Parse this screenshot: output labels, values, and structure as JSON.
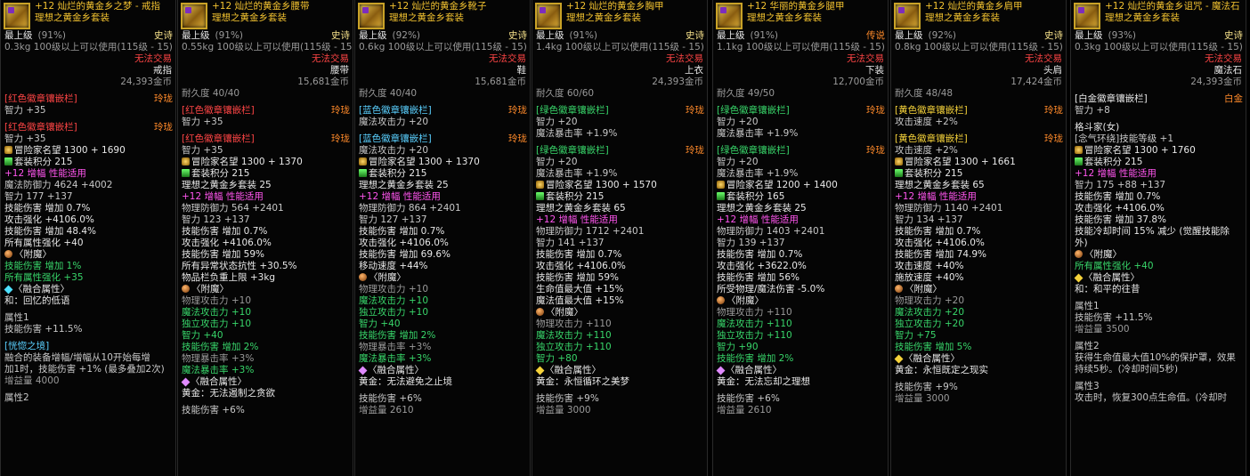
{
  "cards": [
    {
      "title": "+12 灿烂的黄金乡之梦 - 戒指",
      "set": "理想之黄金乡套装",
      "rows": [
        {
          "t": "最上级",
          "p": "(91%)",
          "r": "史诗",
          "rc": "ep",
          "c": "w"
        },
        {
          "t": "0.3kg  100级以上可以使用(115级 - 15)",
          "c": "dg"
        },
        {
          "t": "无法交易",
          "c": "r",
          "align": "right"
        },
        {
          "t": "戒指",
          "c": "w",
          "align": "right"
        },
        {
          "t": "24,393金币",
          "c": "dg",
          "align": "right"
        },
        {
          "gap": 1
        },
        {
          "t": "[红色徽章镶嵌栏]",
          "r": "玲珑",
          "rc": "lg",
          "c": "r"
        },
        {
          "t": "  智力 +35",
          "c": "g"
        },
        {
          "gap": 1
        },
        {
          "t": "[红色徽章镶嵌栏]",
          "r": "玲珑",
          "rc": "lg",
          "c": "r"
        },
        {
          "t": "  智力 +35",
          "c": "g"
        },
        {
          "t": "冒险家名望 1300 + 1690",
          "c": "w",
          "b": "fame"
        },
        {
          "t": "套装积分 215",
          "c": "w",
          "b": "set"
        },
        {
          "t": "+12 增幅 性能适用",
          "c": "pk"
        },
        {
          "t": "魔法防御力 4624 +4002",
          "c": "g"
        },
        {
          "t": "智力 177 +137",
          "c": "g"
        },
        {
          "t": "技能伤害 增加 0.7%",
          "c": "w"
        },
        {
          "t": "攻击强化 +4106.0%",
          "c": "w"
        },
        {
          "t": "技能伤害 增加 48.4%",
          "c": "w"
        },
        {
          "t": "所有属性强化 +40",
          "c": "w"
        },
        {
          "t": "〈附魔〉",
          "c": "w",
          "b": "ench"
        },
        {
          "t": "技能伤害 增加 1%",
          "c": "gr"
        },
        {
          "t": "所有属性强化 +35",
          "c": "gr"
        },
        {
          "t": "〈融合属性〉",
          "c": "w",
          "b": "cyan"
        },
        {
          "t": "  和：回忆的低语",
          "c": "w"
        },
        {
          "gap": 1
        },
        {
          "t": "属性1",
          "c": "g"
        },
        {
          "t": "技能伤害 +11.5%",
          "c": "g"
        },
        {
          "gap": 1
        },
        {
          "t": "[恍惚之境]",
          "c": "bl"
        },
        {
          "t": "融合的装备增幅/增幅从10开始每增",
          "c": "g"
        },
        {
          "t": "加1时，技能伤害 +1% (最多叠加2次)",
          "c": "g"
        },
        {
          "t": "增益量 4000",
          "c": "dg"
        },
        {
          "gap": 1
        },
        {
          "t": "属性2",
          "c": "g"
        }
      ]
    },
    {
      "title": "+12 灿烂的黄金乡腰带",
      "set": "理想之黄金乡套装",
      "rows": [
        {
          "t": "最上级",
          "p": "(91%)",
          "r": "史诗",
          "rc": "ep",
          "c": "w"
        },
        {
          "t": "0.55kg 100级以上可以使用(115级 - 15)",
          "c": "dg"
        },
        {
          "t": "无法交易",
          "c": "r",
          "align": "right"
        },
        {
          "t": "腰带",
          "c": "w",
          "align": "right"
        },
        {
          "t": "15,681金币",
          "c": "dg",
          "align": "right"
        },
        {
          "t": "耐久度 40/40",
          "c": "dg"
        },
        {
          "gap": 1
        },
        {
          "t": "[红色徽章镶嵌栏]",
          "r": "玲珑",
          "rc": "lg",
          "c": "r"
        },
        {
          "t": "  智力 +35",
          "c": "g"
        },
        {
          "gap": 1
        },
        {
          "t": "[红色徽章镶嵌栏]",
          "r": "玲珑",
          "rc": "lg",
          "c": "r"
        },
        {
          "t": "  智力 +35",
          "c": "g"
        },
        {
          "t": "冒险家名望 1300 + 1370",
          "c": "w",
          "b": "fame"
        },
        {
          "t": "套装积分 215",
          "c": "w",
          "b": "set"
        },
        {
          "t": "  理想之黄金乡套装 25",
          "c": "w"
        },
        {
          "t": "+12 增幅 性能适用",
          "c": "pk"
        },
        {
          "t": "物理防御力 564 +2401",
          "c": "g"
        },
        {
          "t": "智力 123 +137",
          "c": "g"
        },
        {
          "t": "技能伤害 增加 0.7%",
          "c": "w"
        },
        {
          "t": "攻击强化 +4106.0%",
          "c": "w"
        },
        {
          "t": "技能伤害 增加 59%",
          "c": "w"
        },
        {
          "t": "所有异常状态抗性 +30.5%",
          "c": "w"
        },
        {
          "t": "物品栏负重上限 +3kg",
          "c": "w"
        },
        {
          "t": "〈附魔〉",
          "c": "w",
          "b": "ench"
        },
        {
          "t": "物理攻击力 +10",
          "c": "dg"
        },
        {
          "t": "魔法攻击力 +10",
          "c": "gr"
        },
        {
          "t": "独立攻击力 +10",
          "c": "gr"
        },
        {
          "t": "智力 +40",
          "c": "gr"
        },
        {
          "t": "技能伤害 增加 2%",
          "c": "gr"
        },
        {
          "t": "物理暴击率 +3%",
          "c": "dg"
        },
        {
          "t": "魔法暴击率 +3%",
          "c": "gr"
        },
        {
          "t": "〈融合属性〉",
          "c": "w",
          "b": "fuse"
        },
        {
          "t": "  黄金：无法遏制之贪欲",
          "c": "w"
        },
        {
          "gap": 1
        },
        {
          "t": "技能伤害 +6%",
          "c": "g"
        }
      ]
    },
    {
      "title": "+12 灿烂的黄金乡靴子",
      "set": "理想之黄金乡套装",
      "rows": [
        {
          "t": "最上级",
          "p": "(92%)",
          "r": "史诗",
          "rc": "ep",
          "c": "w"
        },
        {
          "t": "0.6kg  100级以上可以使用(115级 - 15)",
          "c": "dg"
        },
        {
          "t": "无法交易",
          "c": "r",
          "align": "right"
        },
        {
          "t": "鞋",
          "c": "w",
          "align": "right"
        },
        {
          "t": "15,681金币",
          "c": "dg",
          "align": "right"
        },
        {
          "t": "耐久度 40/40",
          "c": "dg"
        },
        {
          "gap": 1
        },
        {
          "t": "[蓝色徽章镶嵌栏]",
          "r": "玲珑",
          "rc": "lg",
          "c": "bl"
        },
        {
          "t": "  魔法攻击力 +20",
          "c": "g"
        },
        {
          "gap": 1
        },
        {
          "t": "[蓝色徽章镶嵌栏]",
          "r": "玲珑",
          "rc": "lg",
          "c": "bl"
        },
        {
          "t": "  魔法攻击力 +20",
          "c": "g"
        },
        {
          "t": "冒险家名望 1300 + 1370",
          "c": "w",
          "b": "fame"
        },
        {
          "t": "套装积分 215",
          "c": "w",
          "b": "set"
        },
        {
          "t": "  理想之黄金乡套装 25",
          "c": "w"
        },
        {
          "t": "+12 增幅 性能适用",
          "c": "pk"
        },
        {
          "t": "物理防御力 864 +2401",
          "c": "g"
        },
        {
          "t": "智力 127 +137",
          "c": "g"
        },
        {
          "t": "技能伤害 增加 0.7%",
          "c": "w"
        },
        {
          "t": "攻击强化 +4106.0%",
          "c": "w"
        },
        {
          "t": "技能伤害 增加 69.6%",
          "c": "w"
        },
        {
          "t": "移动速度 +44%",
          "c": "w"
        },
        {
          "t": "〈附魔〉",
          "c": "w",
          "b": "ench"
        },
        {
          "t": "物理攻击力 +10",
          "c": "dg"
        },
        {
          "t": "魔法攻击力 +10",
          "c": "gr"
        },
        {
          "t": "独立攻击力 +10",
          "c": "gr"
        },
        {
          "t": "智力 +40",
          "c": "gr"
        },
        {
          "t": "技能伤害 增加 2%",
          "c": "gr"
        },
        {
          "t": "物理暴击率 +3%",
          "c": "dg"
        },
        {
          "t": "魔法暴击率 +3%",
          "c": "gr"
        },
        {
          "t": "〈融合属性〉",
          "c": "w",
          "b": "fuse"
        },
        {
          "t": "  黄金：无法避免之止境",
          "c": "w"
        },
        {
          "gap": 1
        },
        {
          "t": "技能伤害 +6%",
          "c": "g"
        },
        {
          "t": "增益量 2610",
          "c": "dg"
        }
      ]
    },
    {
      "title": "+12 灿烂的黄金乡胸甲",
      "set": "理想之黄金乡套装",
      "rows": [
        {
          "t": "最上级",
          "p": "(91%)",
          "r": "史诗",
          "rc": "ep",
          "c": "w"
        },
        {
          "t": "1.4kg  100级以上可以使用(115级 - 15)",
          "c": "dg"
        },
        {
          "t": "无法交易",
          "c": "r",
          "align": "right"
        },
        {
          "t": "上衣",
          "c": "w",
          "align": "right"
        },
        {
          "t": "24,393金币",
          "c": "dg",
          "align": "right"
        },
        {
          "t": "耐久度 60/60",
          "c": "dg"
        },
        {
          "gap": 1
        },
        {
          "t": "[绿色徽章镶嵌栏]",
          "r": "玲珑",
          "rc": "lg",
          "c": "gr"
        },
        {
          "t": "  智力 +20",
          "c": "g"
        },
        {
          "t": "  魔法暴击率 +1.9%",
          "c": "g"
        },
        {
          "gap": 1
        },
        {
          "t": "[绿色徽章镶嵌栏]",
          "r": "玲珑",
          "rc": "lg",
          "c": "gr"
        },
        {
          "t": "  智力 +20",
          "c": "g"
        },
        {
          "t": "  魔法暴击率 +1.9%",
          "c": "g"
        },
        {
          "t": "冒险家名望 1300 + 1570",
          "c": "w",
          "b": "fame"
        },
        {
          "t": "套装积分 215",
          "c": "w",
          "b": "set"
        },
        {
          "t": "  理想之黄金乡套装 65",
          "c": "w"
        },
        {
          "t": "+12 增幅 性能适用",
          "c": "pk"
        },
        {
          "t": "物理防御力 1712 +2401",
          "c": "g"
        },
        {
          "t": "智力 141 +137",
          "c": "g"
        },
        {
          "t": "技能伤害 增加 0.7%",
          "c": "w"
        },
        {
          "t": "攻击强化 +4106.0%",
          "c": "w"
        },
        {
          "t": "技能伤害 增加 59%",
          "c": "w"
        },
        {
          "t": "生命值最大值 +15%",
          "c": "w"
        },
        {
          "t": "魔法值最大值 +15%",
          "c": "w"
        },
        {
          "t": "〈附魔〉",
          "c": "w",
          "b": "ench"
        },
        {
          "t": "物理攻击力 +110",
          "c": "dg"
        },
        {
          "t": "魔法攻击力 +110",
          "c": "gr"
        },
        {
          "t": "独立攻击力 +110",
          "c": "gr"
        },
        {
          "t": "智力 +80",
          "c": "gr"
        },
        {
          "t": "〈融合属性〉",
          "c": "w",
          "b": "fuse2"
        },
        {
          "t": "  黄金：永恒循环之美梦",
          "c": "w"
        },
        {
          "gap": 1
        },
        {
          "t": "技能伤害 +9%",
          "c": "g"
        },
        {
          "t": "增益量 3000",
          "c": "dg"
        }
      ]
    },
    {
      "title": "+12 华丽的黄金乡腿甲",
      "set": "理想之黄金乡套装",
      "rows": [
        {
          "t": "最上级",
          "p": "(91%)",
          "r": "传说",
          "rc": "lg",
          "c": "w"
        },
        {
          "t": "1.1kg  100级以上可以使用(115级 - 15)",
          "c": "dg"
        },
        {
          "t": "无法交易",
          "c": "r",
          "align": "right"
        },
        {
          "t": "下装",
          "c": "w",
          "align": "right"
        },
        {
          "t": "12,700金币",
          "c": "dg",
          "align": "right"
        },
        {
          "t": "耐久度 49/50",
          "c": "dg"
        },
        {
          "gap": 1
        },
        {
          "t": "[绿色徽章镶嵌栏]",
          "r": "玲珑",
          "rc": "lg",
          "c": "gr"
        },
        {
          "t": "  智力 +20",
          "c": "g"
        },
        {
          "t": "  魔法暴击率 +1.9%",
          "c": "g"
        },
        {
          "gap": 1
        },
        {
          "t": "[绿色徽章镶嵌栏]",
          "r": "玲珑",
          "rc": "lg",
          "c": "gr"
        },
        {
          "t": "  智力 +20",
          "c": "g"
        },
        {
          "t": "  魔法暴击率 +1.9%",
          "c": "g"
        },
        {
          "t": "冒险家名望 1200 + 1400",
          "c": "w",
          "b": "fame"
        },
        {
          "t": "套装积分 165",
          "c": "w",
          "b": "set"
        },
        {
          "t": "  理想之黄金乡套装 25",
          "c": "w"
        },
        {
          "t": "+12 增幅 性能适用",
          "c": "pk"
        },
        {
          "t": "物理防御力 1403 +2401",
          "c": "g"
        },
        {
          "t": "智力 139 +137",
          "c": "g"
        },
        {
          "t": "技能伤害 增加 0.7%",
          "c": "w"
        },
        {
          "t": "攻击强化 +3622.0%",
          "c": "w"
        },
        {
          "t": "技能伤害 增加 56%",
          "c": "w"
        },
        {
          "t": "所受物理/魔法伤害 -5.0%",
          "c": "w"
        },
        {
          "t": "〈附魔〉",
          "c": "w",
          "b": "ench"
        },
        {
          "t": "物理攻击力 +110",
          "c": "dg"
        },
        {
          "t": "魔法攻击力 +110",
          "c": "gr"
        },
        {
          "t": "独立攻击力 +110",
          "c": "gr"
        },
        {
          "t": "智力 +90",
          "c": "gr"
        },
        {
          "t": "技能伤害 增加 2%",
          "c": "gr"
        },
        {
          "t": "〈融合属性〉",
          "c": "w",
          "b": "fuse"
        },
        {
          "t": "  黄金：无法忘却之理想",
          "c": "w"
        },
        {
          "gap": 1
        },
        {
          "t": "技能伤害 +6%",
          "c": "g"
        },
        {
          "t": "增益量 2610",
          "c": "dg"
        }
      ]
    },
    {
      "title": "+12 灿烂的黄金乡肩甲",
      "set": "理想之黄金乡套装",
      "rows": [
        {
          "t": "最上级",
          "p": "(92%)",
          "r": "史诗",
          "rc": "ep",
          "c": "w"
        },
        {
          "t": "0.8kg  100级以上可以使用(115级 - 15)",
          "c": "dg"
        },
        {
          "t": "无法交易",
          "c": "r",
          "align": "right"
        },
        {
          "t": "头肩",
          "c": "w",
          "align": "right"
        },
        {
          "t": "17,424金币",
          "c": "dg",
          "align": "right"
        },
        {
          "t": "耐久度 48/48",
          "c": "dg"
        },
        {
          "gap": 1
        },
        {
          "t": "[黄色徽章镶嵌栏]",
          "r": "玲珑",
          "rc": "lg",
          "c": "y"
        },
        {
          "t": "  攻击速度 +2%",
          "c": "g"
        },
        {
          "gap": 1
        },
        {
          "t": "[黄色徽章镶嵌栏]",
          "r": "玲珑",
          "rc": "lg",
          "c": "y"
        },
        {
          "t": "  攻击速度 +2%",
          "c": "g"
        },
        {
          "t": "冒险家名望 1300 + 1661",
          "c": "w",
          "b": "fame"
        },
        {
          "t": "套装积分 215",
          "c": "w",
          "b": "set"
        },
        {
          "t": "  理想之黄金乡套装 65",
          "c": "w"
        },
        {
          "t": "+12 增幅 性能适用",
          "c": "pk"
        },
        {
          "t": "物理防御力 1140 +2401",
          "c": "g"
        },
        {
          "t": "智力 134 +137",
          "c": "g"
        },
        {
          "t": "技能伤害 增加 0.7%",
          "c": "w"
        },
        {
          "t": "攻击强化 +4106.0%",
          "c": "w"
        },
        {
          "t": "技能伤害 增加 74.9%",
          "c": "w"
        },
        {
          "t": "攻击速度 +40%",
          "c": "w"
        },
        {
          "t": "施放速度 +40%",
          "c": "w"
        },
        {
          "t": "〈附魔〉",
          "c": "w",
          "b": "ench"
        },
        {
          "t": "物理攻击力 +20",
          "c": "dg"
        },
        {
          "t": "魔法攻击力 +20",
          "c": "gr"
        },
        {
          "t": "独立攻击力 +20",
          "c": "gr"
        },
        {
          "t": "智力 +75",
          "c": "gr"
        },
        {
          "t": "技能伤害 增加 5%",
          "c": "gr"
        },
        {
          "t": "〈融合属性〉",
          "c": "w",
          "b": "fuse2"
        },
        {
          "t": "  黄金：永恒既定之现实",
          "c": "w"
        },
        {
          "gap": 1
        },
        {
          "t": "技能伤害 +9%",
          "c": "g"
        },
        {
          "t": "增益量 3000",
          "c": "dg"
        }
      ]
    },
    {
      "title": "+12 灿烂的黄金乡诅咒 - 魔法石",
      "set": "理想之黄金乡套装",
      "rows": [
        {
          "t": "最上级",
          "p": "(93%)",
          "r": "史诗",
          "rc": "ep",
          "c": "w"
        },
        {
          "t": "0.3kg  100级以上可以使用(115级 - 15)",
          "c": "dg"
        },
        {
          "t": "无法交易",
          "c": "r",
          "align": "right"
        },
        {
          "t": "魔法石",
          "c": "w",
          "align": "right"
        },
        {
          "t": "24,393金币",
          "c": "dg",
          "align": "right"
        },
        {
          "gap": 1
        },
        {
          "t": "[白金徽章镶嵌栏]",
          "r": "白金",
          "rc": "lg",
          "c": "w"
        },
        {
          "t": "  智力 +8",
          "c": "g"
        },
        {
          "gap": 1
        },
        {
          "t": "  格斗家(女)",
          "c": "w"
        },
        {
          "t": "  [念气环绕]技能等级 +1",
          "c": "g"
        },
        {
          "t": "冒险家名望 1300 + 1760",
          "c": "w",
          "b": "fame"
        },
        {
          "t": "套装积分 215",
          "c": "w",
          "b": "set"
        },
        {
          "t": "+12 增幅 性能适用",
          "c": "pk"
        },
        {
          "t": "智力 175 +88 +137",
          "c": "g"
        },
        {
          "t": "技能伤害 增加 0.7%",
          "c": "w"
        },
        {
          "t": "攻击强化 +4106.0%",
          "c": "w"
        },
        {
          "t": "技能伤害 增加 37.8%",
          "c": "w"
        },
        {
          "t": "技能冷却时间 15% 减少 (觉醒技能除",
          "c": "w"
        },
        {
          "t": "外)",
          "c": "w"
        },
        {
          "t": "〈附魔〉",
          "c": "w",
          "b": "ench"
        },
        {
          "t": "所有属性强化 +40",
          "c": "gr"
        },
        {
          "t": "〈融合属性〉",
          "c": "w",
          "b": "fuse2"
        },
        {
          "t": "  和：和平的往昔",
          "c": "w"
        },
        {
          "gap": 1
        },
        {
          "t": "属性1",
          "c": "g"
        },
        {
          "t": "技能伤害 +11.5%",
          "c": "g"
        },
        {
          "t": "增益量 3500",
          "c": "dg"
        },
        {
          "gap": 1
        },
        {
          "t": "属性2",
          "c": "g"
        },
        {
          "t": "获得生命值最大值10%的保护罩，效果",
          "c": "g"
        },
        {
          "t": "持续5秒。(冷却时间5秒)",
          "c": "g"
        },
        {
          "gap": 1
        },
        {
          "t": "属性3",
          "c": "g"
        },
        {
          "t": "攻击时，恢复300点生命值。(冷却时",
          "c": "g"
        }
      ]
    }
  ]
}
